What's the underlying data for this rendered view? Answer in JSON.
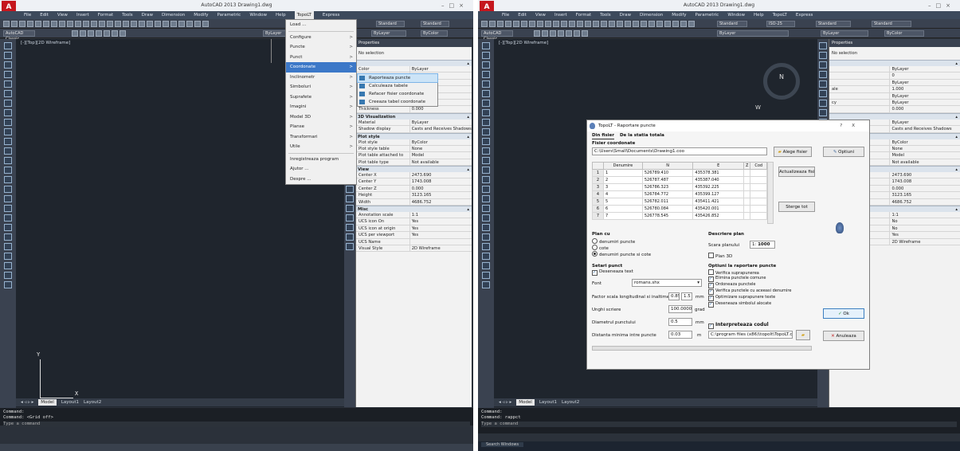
{
  "left": {
    "app_title": "AutoCAD 2013  Drawing1.dwg",
    "menus": [
      "File",
      "Edit",
      "View",
      "Insert",
      "Format",
      "Tools",
      "Draw",
      "Dimension",
      "Modify",
      "Parametric",
      "Window",
      "Help",
      "TopoLT",
      "Express"
    ],
    "active_menu": "TopoLT",
    "workspace": "AutoCAD Classic",
    "view_label": "[-][Top][2D Wireframe]",
    "text_style": "Standard",
    "dim_style": "Standard",
    "layer_color": "ByLayer",
    "layer_value": "ByLayer",
    "bycolor": "ByColor",
    "layout_tabs": [
      "Model",
      "Layout1",
      "Layout2"
    ],
    "command_lines": [
      "Command:",
      "Command: <Grid off>"
    ],
    "command_placeholder": "Type a command",
    "ucs_y": "Y",
    "ucs_x": "X",
    "dropdown": [
      {
        "label": "Load ...",
        "arrow": ""
      },
      {
        "label": "Configure",
        "arrow": ">"
      },
      {
        "label": "Puncte",
        "arrow": ">"
      },
      {
        "label": "Punct",
        "arrow": ">"
      },
      {
        "label": "Coordonate",
        "arrow": ">"
      },
      {
        "label": "Inclinometr",
        "arrow": ">"
      },
      {
        "label": "Simboluri",
        "arrow": ">"
      },
      {
        "label": "Suprafete",
        "arrow": ">"
      },
      {
        "label": "Imagini",
        "arrow": ">"
      },
      {
        "label": "Model 3D",
        "arrow": ">"
      },
      {
        "label": "Planse",
        "arrow": ">"
      },
      {
        "label": "Transformari",
        "arrow": ">"
      },
      {
        "label": "Utile",
        "arrow": ">"
      },
      {
        "label": "Inregistreaza program",
        "arrow": ""
      },
      {
        "label": "Ajutor ...",
        "arrow": ""
      },
      {
        "label": "Despre ...",
        "arrow": ""
      }
    ],
    "submenu": [
      "Raporteaza puncte",
      "Calculeaza tabele",
      "Refacer fisier coordonate",
      "Creeaza tabel coordonate"
    ],
    "props_title": "Properties",
    "props_selection": "No selection",
    "props_general": [
      {
        "k": "Color",
        "v": "ByLayer"
      },
      {
        "k": "Layer",
        "v": "0"
      },
      {
        "k": "Linetype",
        "v": "ByLayer"
      },
      {
        "k": "Linetype scale",
        "v": "1.000"
      },
      {
        "k": "Lineweight",
        "v": "ByLayer"
      },
      {
        "k": "Transparency",
        "v": "ByLayer"
      },
      {
        "k": "Thickness",
        "v": "0.000"
      }
    ],
    "sec_3d": "3D Visualization",
    "props_3d": [
      {
        "k": "Material",
        "v": "ByLayer"
      },
      {
        "k": "Shadow display",
        "v": "Casts and Receives Shadows"
      }
    ],
    "sec_plot": "Plot style",
    "props_plot": [
      {
        "k": "Plot style",
        "v": "ByColor"
      },
      {
        "k": "Plot style table",
        "v": "None"
      },
      {
        "k": "Plot table attached to",
        "v": "Model"
      },
      {
        "k": "Plot table type",
        "v": "Not available"
      }
    ],
    "sec_view": "View",
    "props_view": [
      {
        "k": "Center X",
        "v": "2473.690"
      },
      {
        "k": "Center Y",
        "v": "1743.008"
      },
      {
        "k": "Center Z",
        "v": "0.000"
      },
      {
        "k": "Height",
        "v": "3123.165"
      },
      {
        "k": "Width",
        "v": "4686.752"
      }
    ],
    "sec_misc": "Misc",
    "props_misc": [
      {
        "k": "Annotation scale",
        "v": "1:1"
      },
      {
        "k": "UCS icon On",
        "v": "Yes"
      },
      {
        "k": "UCS icon at origin",
        "v": "Yes"
      },
      {
        "k": "UCS per viewport",
        "v": "Yes"
      },
      {
        "k": "UCS Name",
        "v": ""
      },
      {
        "k": "Visual Style",
        "v": "2D Wireframe"
      }
    ]
  },
  "right": {
    "app_title": "AutoCAD 2013  Drawing1.dwg",
    "view_label": "[-][Top][2D Wireframe]",
    "compass_n": "N",
    "compass_w": "W",
    "text_style": "Standard",
    "dim_style": "ISO-25",
    "table_style": "Standard",
    "mleader_style": "Standard",
    "layer_value": "ByLayer",
    "bycolor": "ByColor",
    "layout_tabs": [
      "Model",
      "Layout1",
      "Layout2"
    ],
    "command_lines": [
      "Command:",
      "Command: rappct"
    ],
    "command_placeholder": "Type a command",
    "taskbar_search": "Search Windows",
    "props_selection": "No selection",
    "props_general_values": [
      "ByLayer",
      "0",
      "ByLayer",
      "1.000",
      "ByLayer",
      "ByLayer",
      "0.000"
    ],
    "props_keys_partial": [
      "ale",
      "cy",
      "play",
      "able",
      "ttached to",
      "ype",
      "scale",
      "n",
      "t origin",
      "wport"
    ],
    "props_values_partial": [
      "ByLayer",
      "Casts and Receives Shadows",
      "ByColor",
      "None",
      "Model",
      "Not available",
      "2473.690",
      "1743.008",
      "0.000",
      "3123.165",
      "4686.752",
      "1:1",
      "No",
      "No",
      "Yes",
      "2D Wireframe"
    ],
    "dialog": {
      "title": "TopoLT - Raportare puncte",
      "help": "?",
      "close": "X",
      "tabs": [
        "Din fisier",
        "De la statia totala"
      ],
      "file_label": "Fisier coordonate",
      "file_path": "C:\\Users\\Small\\Documents\\Drawing1.coo",
      "choose_file_btn": "Alege fisier",
      "options_btn": "Optiuni",
      "update_file_btn": "Actualizeaza fisier",
      "delete_list_btn": "Sterge tot",
      "ok_btn": "Ok",
      "cancel_btn": "Anuleaza",
      "columns": [
        "Denumire",
        "N",
        "E",
        "Z",
        "Cod"
      ],
      "rows": [
        [
          "1",
          "1",
          "526789.410",
          "435378.381",
          "",
          ""
        ],
        [
          "2",
          "2",
          "526787.487",
          "435387.040",
          "",
          ""
        ],
        [
          "3",
          "3",
          "526786.323",
          "435392.225",
          "",
          ""
        ],
        [
          "4",
          "4",
          "526784.772",
          "435399.127",
          "",
          ""
        ],
        [
          "5",
          "5",
          "526782.011",
          "435411.421",
          "",
          ""
        ],
        [
          "6",
          "6",
          "526780.084",
          "435420.001",
          "",
          ""
        ],
        [
          "7",
          "7",
          "526778.545",
          "435426.852",
          "",
          ""
        ]
      ],
      "plan_section": "Plan cu",
      "plan_options": [
        "denumiri puncte",
        "cote",
        "denumiri puncte si cote"
      ],
      "plan_selected": 2,
      "desc_section": "Descriere plan",
      "scale_label": "Scara planului",
      "scale_prefix": "1:",
      "scale_value": "1000",
      "plan3d_label": "Plan 3D",
      "settings_section": "Setari punct",
      "draw_text": "Deseneaza text",
      "font_label": "Font",
      "font_value": "romans.shx",
      "factor_label": "Factor scala longitudinal si inaltime text",
      "factor_a": "0.85",
      "factor_b": "1.5",
      "factor_unit": "mm",
      "angle_label": "Unghi scriere",
      "angle_value": "100.0000",
      "angle_unit": "grad",
      "diam_label": "Diametrul punctului",
      "diam_value": "0.5",
      "diam_unit": "mm",
      "dist_label": "Distanta minima intre puncte",
      "dist_value": "0.03",
      "dist_unit": "m",
      "opt_section": "Optiuni la raportare puncte",
      "options": [
        {
          "label": "Verifica suprapunerea",
          "on": false
        },
        {
          "label": "Elimina punctele comune",
          "on": true
        },
        {
          "label": "Ordoneaza punctele",
          "on": true
        },
        {
          "label": "Verifica punctele cu aceeasi denumire",
          "on": true
        },
        {
          "label": "Optimizare suprapunere texte",
          "on": true
        },
        {
          "label": "Deseneaza simbolul alocate",
          "on": true
        }
      ],
      "interpret_label": "Interpreteaza codul",
      "code_path": "C:\\program files (x86)\\topolt\\TopoLT.cod"
    }
  }
}
